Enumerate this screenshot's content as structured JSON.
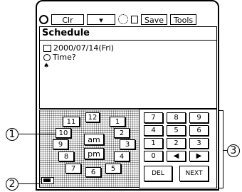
{
  "toolbar": {
    "clr": "Clr",
    "down": "▾",
    "save": "Save",
    "tools": "Tools"
  },
  "screen": {
    "title": "Schedule",
    "date": "2000/07/14(Fri)",
    "time": "Time?"
  },
  "clock": {
    "hours": [
      "12",
      "1",
      "2",
      "3",
      "4",
      "5",
      "6",
      "7",
      "8",
      "9",
      "10",
      "11"
    ],
    "am": "am",
    "pm": "pm"
  },
  "numpad": {
    "keys": [
      "7",
      "8",
      "9",
      "4",
      "5",
      "6",
      "1",
      "2",
      "3",
      "0",
      "◀",
      "▶"
    ],
    "del": "DEL",
    "next": "NEXT"
  },
  "callouts": {
    "one": "1",
    "two": "2",
    "three": "3"
  }
}
